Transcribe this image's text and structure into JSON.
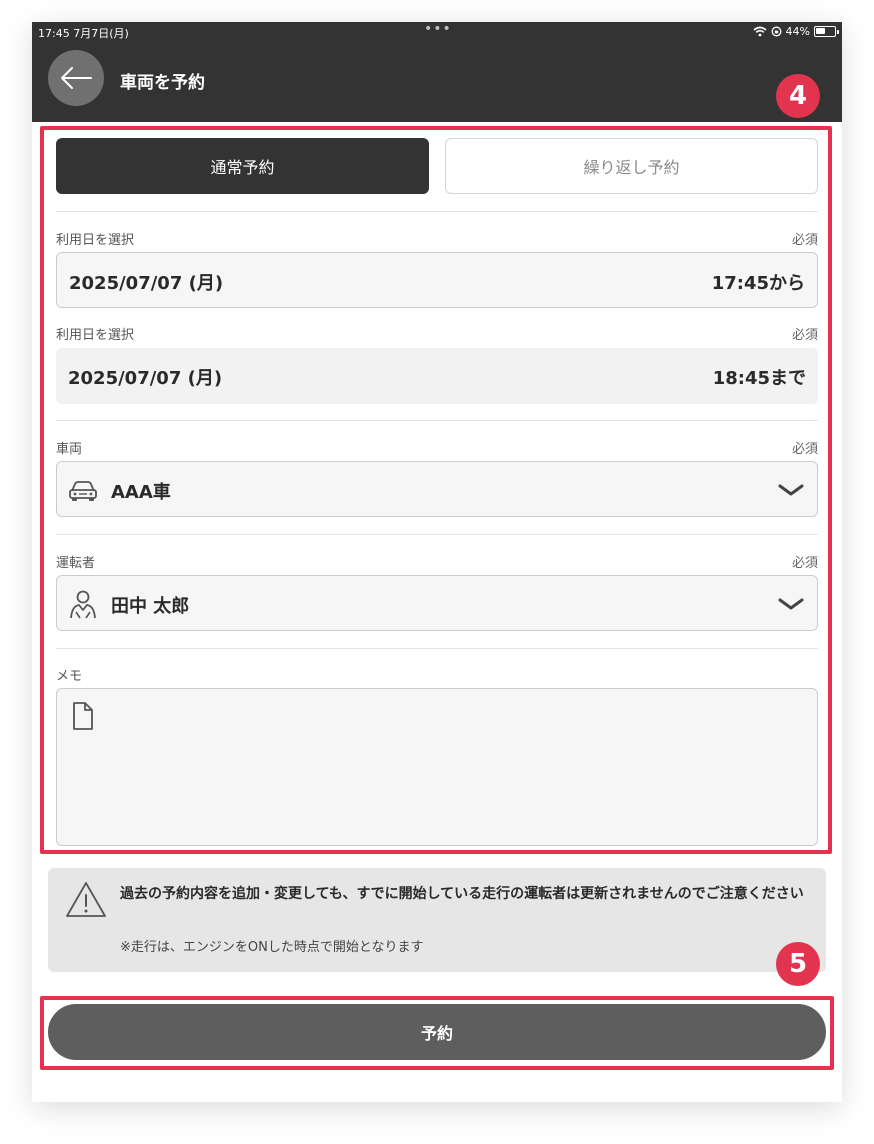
{
  "status_bar": {
    "time_date": "17:45 7月7日(月)",
    "dots": "•••",
    "battery_percent": "44%"
  },
  "header": {
    "title": "車両を予約"
  },
  "tabs": [
    {
      "label": "通常予約",
      "active": true
    },
    {
      "label": "繰り返し予約",
      "active": false
    }
  ],
  "form": {
    "start": {
      "label": "利用日を選択",
      "required": "必須",
      "date": "2025/07/07 (月)",
      "time": "17:45から"
    },
    "end": {
      "label": "利用日を選択",
      "required": "必須",
      "date": "2025/07/07 (月)",
      "time": "18:45まで"
    },
    "vehicle": {
      "label": "車両",
      "required": "必須",
      "value": "AAA車",
      "icon": "car-icon"
    },
    "driver": {
      "label": "運転者",
      "required": "必須",
      "value": "田中 太郎",
      "icon": "person-icon"
    },
    "memo": {
      "label": "メモ",
      "icon": "document-icon"
    }
  },
  "notice": {
    "icon": "warning-icon",
    "text": "過去の予約内容を追加・変更しても、すでに開始している走行の運転者は更新されませんのでご注意ください",
    "note": "※走行は、エンジンをONした時点で開始となります"
  },
  "submit_label": "予約",
  "annotations": {
    "badge_1": "4",
    "badge_2": "5",
    "color": "#e2344f"
  },
  "colors": {
    "header_bg": "#333333",
    "active_tab_bg": "#333333",
    "button_bg": "#5e5e5e"
  }
}
